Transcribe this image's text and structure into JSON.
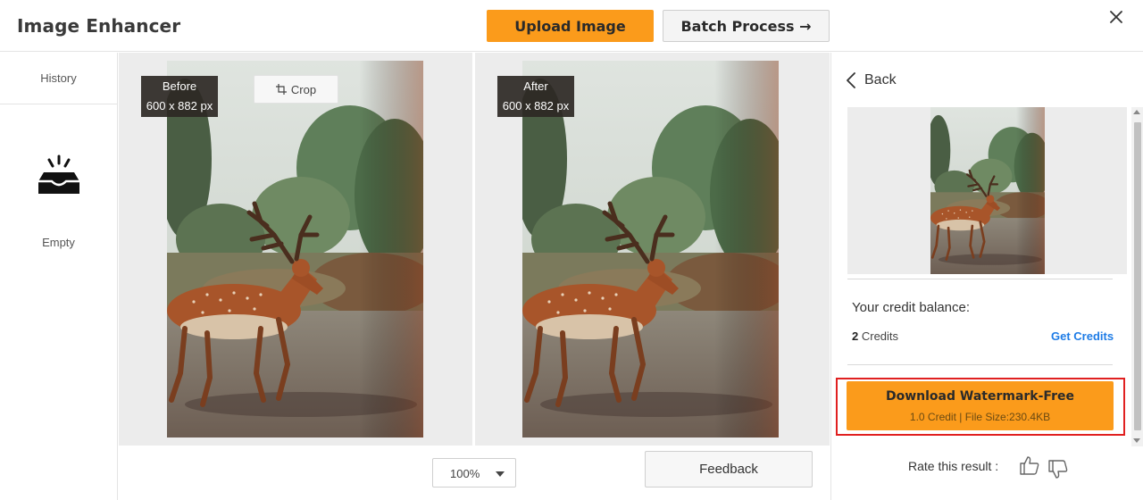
{
  "header": {
    "app_title": "Image Enhancer",
    "upload_label": "Upload Image",
    "batch_label": "Batch Process →",
    "close_icon": "close-icon"
  },
  "sidebar": {
    "history_label": "History",
    "empty_label": "Empty",
    "empty_icon": "empty-tray-icon"
  },
  "compare": {
    "before": {
      "label": "Before",
      "size": "600 x 882 px"
    },
    "after": {
      "label": "After",
      "size": "600 x 882 px"
    },
    "crop_label": "Crop",
    "zoom_value": "100%",
    "feedback_label": "Feedback"
  },
  "right_panel": {
    "back_label": "Back",
    "credit_balance_label": "Your credit balance:",
    "credit_count": "2",
    "credit_unit": " Credits",
    "get_credits_label": "Get Credits",
    "download_title": "Download Watermark-Free",
    "download_sub": "1.0 Credit | File Size:230.4KB",
    "rate_label": "Rate this result :"
  },
  "colors": {
    "accent": "#fb9b1b",
    "link": "#1e7ce6",
    "highlight_outline": "#e02020"
  }
}
